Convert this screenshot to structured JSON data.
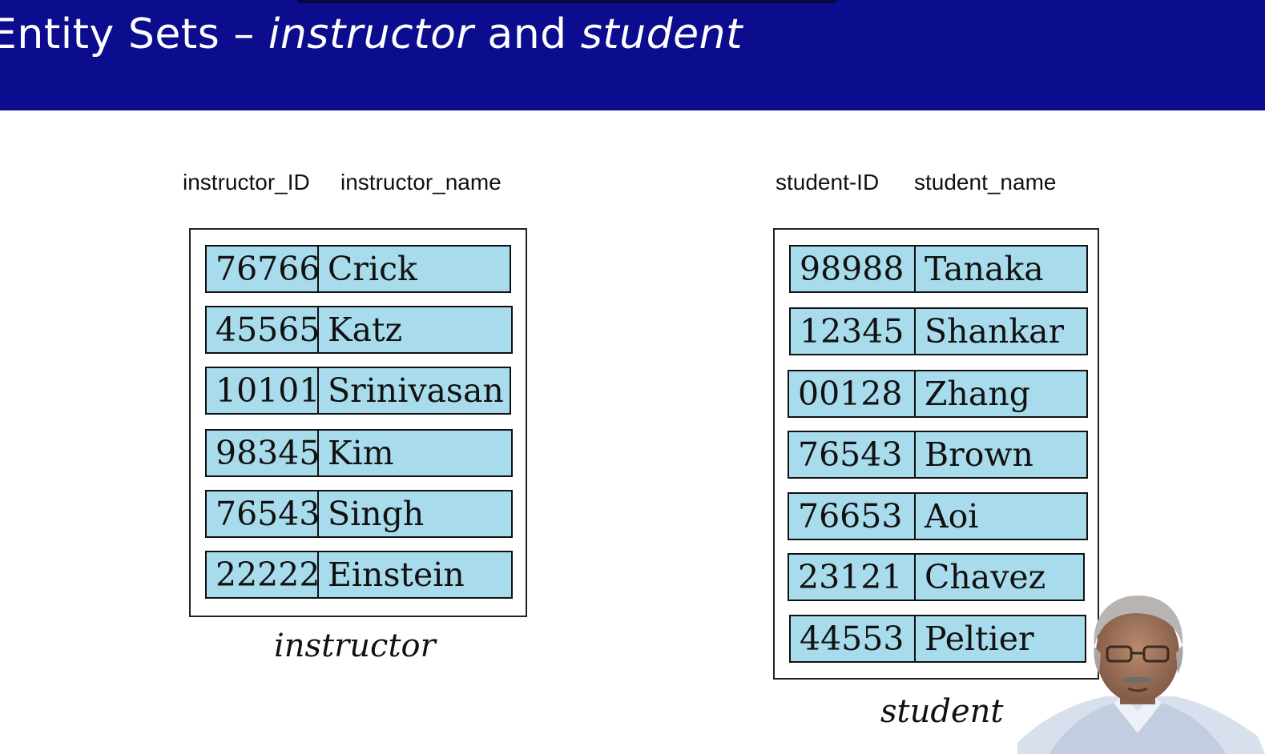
{
  "slide": {
    "title_part1": "Entity Sets – ",
    "title_italic1": "instructor",
    "title_part2": " and ",
    "title_italic2": "student"
  },
  "instructor": {
    "header_id": "instructor_ID",
    "header_name": "instructor_name",
    "caption": "instructor",
    "rows": [
      {
        "id": "76766",
        "name": "Crick"
      },
      {
        "id": "45565",
        "name": "Katz"
      },
      {
        "id": "10101",
        "name": "Srinivasan"
      },
      {
        "id": "98345",
        "name": "Kim"
      },
      {
        "id": "76543",
        "name": "Singh"
      },
      {
        "id": "22222",
        "name": "Einstein"
      }
    ]
  },
  "student": {
    "header_id": "student-ID",
    "header_name": "student_name",
    "caption": "student",
    "rows": [
      {
        "id": "98988",
        "name": "Tanaka"
      },
      {
        "id": "12345",
        "name": "Shankar"
      },
      {
        "id": "00128",
        "name": "Zhang"
      },
      {
        "id": "76543",
        "name": "Brown"
      },
      {
        "id": "76653",
        "name": "Aoi"
      },
      {
        "id": "23121",
        "name": "Chavez"
      },
      {
        "id": "44553",
        "name": "Peltier"
      }
    ]
  },
  "colors": {
    "title_bar": "#0c0c8e",
    "cell_fill": "#a8dcec",
    "text": "#111111"
  }
}
